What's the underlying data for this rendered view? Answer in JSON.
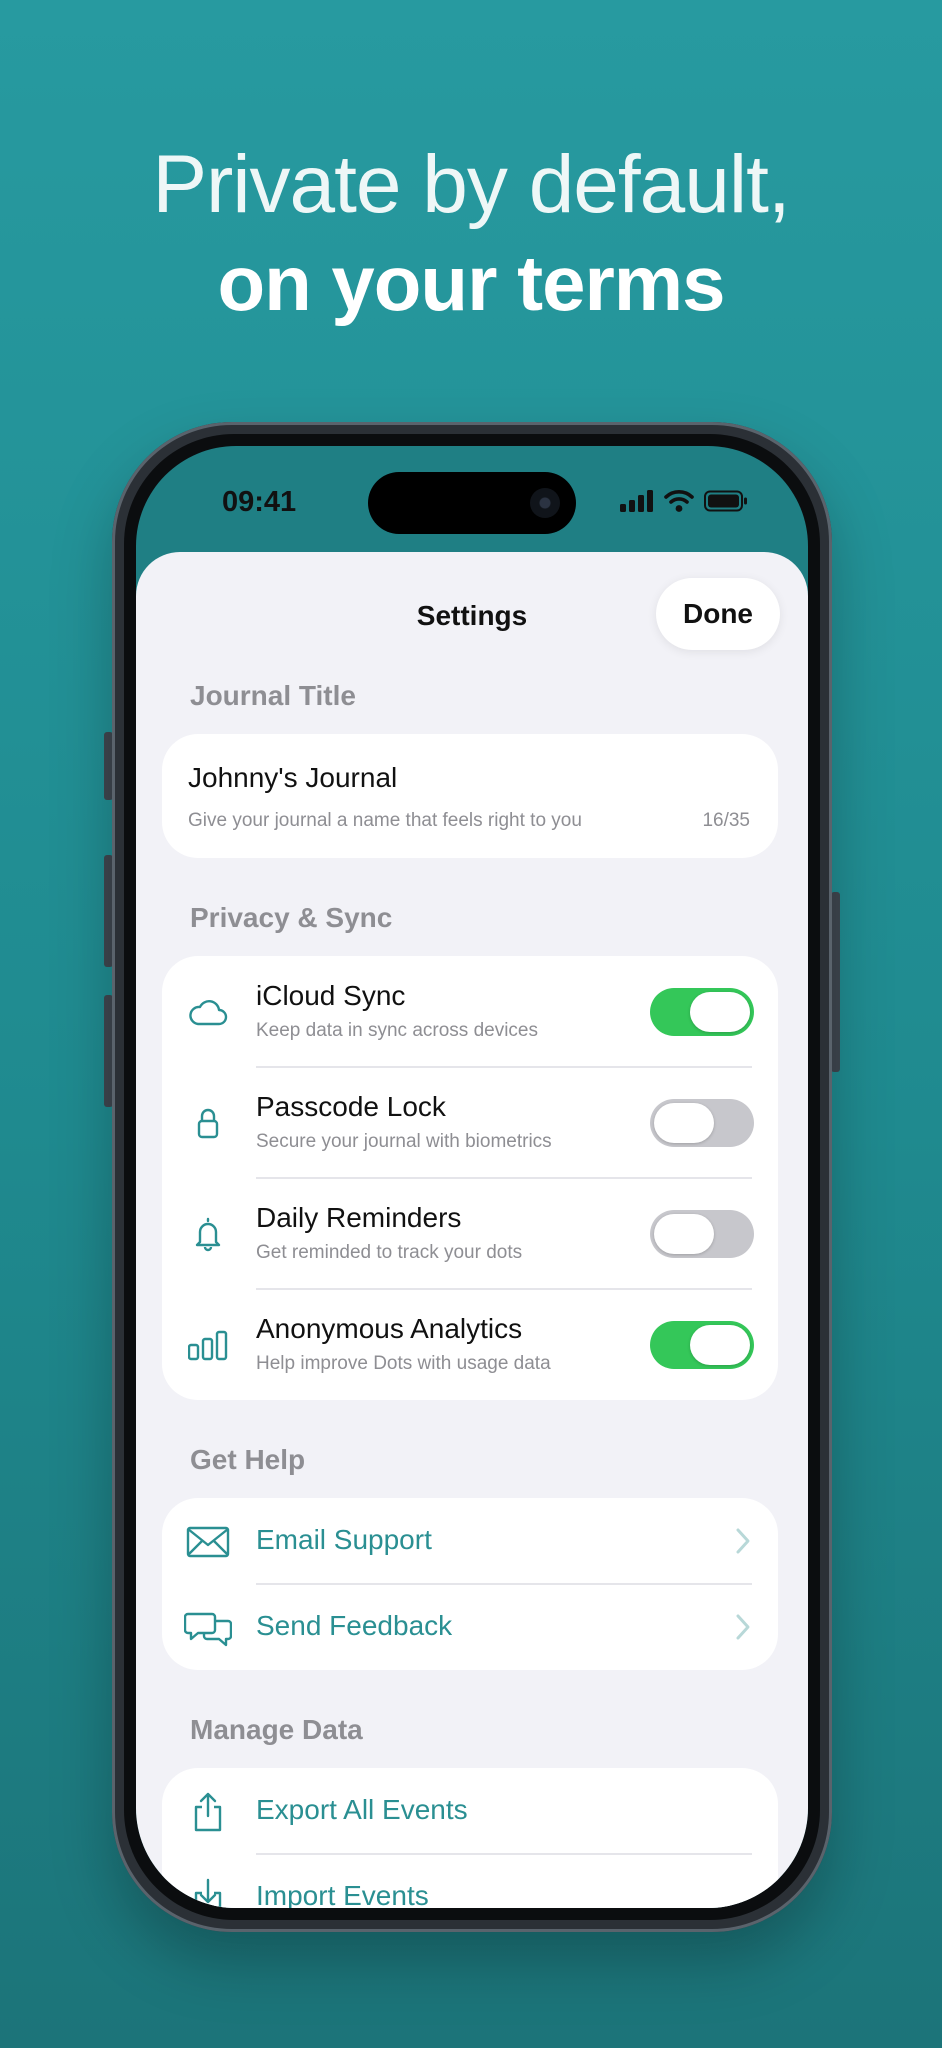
{
  "headline": {
    "line1": "Private by default,",
    "line2": "on your terms"
  },
  "status_bar": {
    "time": "09:41"
  },
  "settings": {
    "title": "Settings",
    "done_label": "Done",
    "journal_section": {
      "label": "Journal Title",
      "value": "Johnny's Journal",
      "hint": "Give your journal a name that feels right to you",
      "count": "16/35"
    },
    "privacy_section": {
      "label": "Privacy & Sync",
      "items": [
        {
          "title": "iCloud Sync",
          "subtitle": "Keep data in sync across devices",
          "icon": "cloud-icon",
          "enabled": true
        },
        {
          "title": "Passcode Lock",
          "subtitle": "Secure your journal with biometrics",
          "icon": "lock-icon",
          "enabled": false
        },
        {
          "title": "Daily Reminders",
          "subtitle": "Get reminded to track your dots",
          "icon": "bell-icon",
          "enabled": false
        },
        {
          "title": "Anonymous Analytics",
          "subtitle": "Help improve Dots with usage data",
          "icon": "chart-icon",
          "enabled": true
        }
      ]
    },
    "help_section": {
      "label": "Get Help",
      "items": [
        {
          "title": "Email Support",
          "icon": "envelope-icon"
        },
        {
          "title": "Send Feedback",
          "icon": "speech-bubbles-icon"
        }
      ]
    },
    "data_section": {
      "label": "Manage Data",
      "items": [
        {
          "title": "Export All Events",
          "icon": "share-icon"
        },
        {
          "title": "Import Events",
          "icon": "import-icon"
        }
      ]
    }
  },
  "colors": {
    "background_teal": "#1f8a8f",
    "accent_teal": "#2a8f92",
    "toggle_on": "#34c759",
    "toggle_off": "#c7c7cc"
  }
}
